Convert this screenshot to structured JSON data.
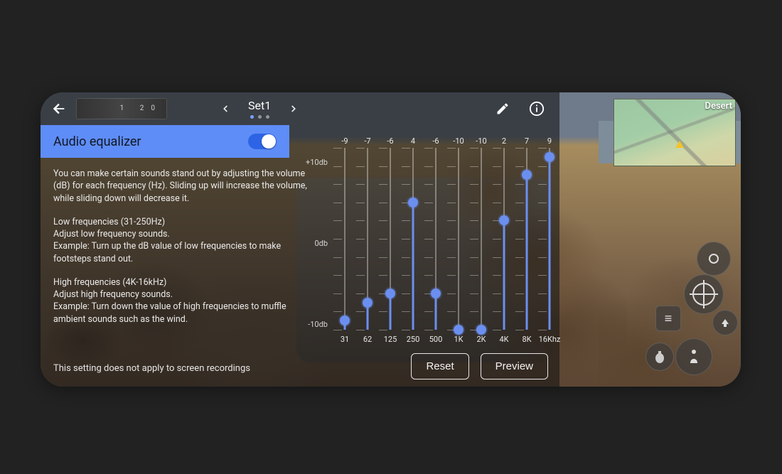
{
  "header": {
    "set_name": "Set1",
    "active_dot": 0,
    "dots": 3
  },
  "panel": {
    "title": "Audio equalizer",
    "toggle_on": true
  },
  "description": {
    "intro": "You can make certain sounds stand out by adjusting the volume (dB) for each frequency (Hz). Sliding up will increase the volume, while sliding down will decrease it.",
    "low_head": "Low frequencies (31-250Hz)",
    "low_line1": "Adjust low frequency sounds.",
    "low_line2": "Example: Turn up the dB value of low frequencies to make footsteps stand out.",
    "high_head": "High frequencies (4K-16kHz)",
    "high_line1": "Adjust high frequency sounds.",
    "high_line2": "Example: Turn down the value of high frequencies to muffle ambient sounds such as the wind.",
    "footnote": "This setting does not apply to screen recordings"
  },
  "equalizer": {
    "y_top": "+10db",
    "y_mid": "0db",
    "y_bot": "-10db",
    "bands": [
      {
        "freq": "31",
        "db": -9
      },
      {
        "freq": "62",
        "db": -7
      },
      {
        "freq": "125",
        "db": -6
      },
      {
        "freq": "250",
        "db": 4
      },
      {
        "freq": "500",
        "db": -6
      },
      {
        "freq": "1K",
        "db": -10
      },
      {
        "freq": "2K",
        "db": -10
      },
      {
        "freq": "4K",
        "db": 2
      },
      {
        "freq": "8K",
        "db": 7
      },
      {
        "freq": "16Khz",
        "db": 9
      }
    ]
  },
  "buttons": {
    "reset": "Reset",
    "preview": "Preview"
  },
  "hud": {
    "location": "Desert"
  }
}
